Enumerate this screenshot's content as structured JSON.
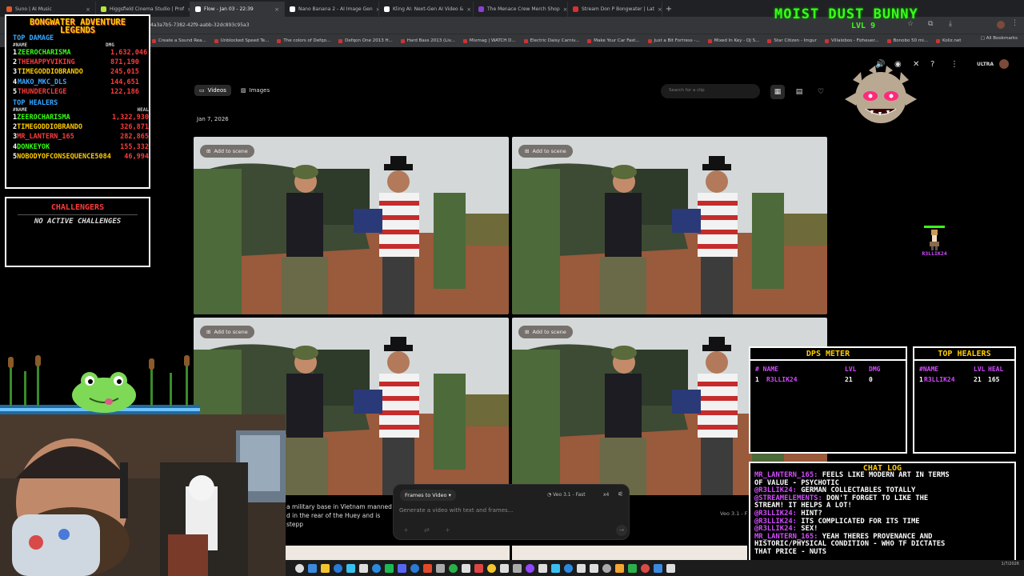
{
  "browser": {
    "tabs": [
      {
        "label": "Suno | AI Music",
        "color": "#e05a2b",
        "active": false
      },
      {
        "label": "Higgsfield Cinema Studio | Prof",
        "color": "#b7e63a",
        "active": false
      },
      {
        "label": "Flow - Jan 03 - 22:39",
        "color": "#ffffff",
        "active": true
      },
      {
        "label": "Nano Banana 2 - AI Image Gen",
        "color": "#ffffff",
        "active": false
      },
      {
        "label": "Kling AI: Next-Gen AI Video &",
        "color": "#ffffff",
        "active": false
      },
      {
        "label": "The Menace Crew Merch Shop",
        "color": "#8b3fd6",
        "active": false
      },
      {
        "label": "Stream Don P Bongwater | Lat",
        "color": "#d93030",
        "active": false
      }
    ],
    "new_tab": "+",
    "url": "4a3a7b5-7382-42f9-aabb-32dc893c95a3",
    "bookmarks": [
      "Create a Sound Rea...",
      "Unblocked Speed Te...",
      "The colors of Defqo...",
      "Defqon One 2013 H...",
      "Hard Bass 2013 (Liv...",
      "Mixmag | WATCH D...",
      "Electric Daisy Carniv...",
      "Make Your Car Fast...",
      "Just a Bit Fortress -...",
      "Mixed In Key - DJ S...",
      "Star Citizen - Imgur",
      "Villalobos - Fizheuer...",
      "Bonobo 50 mi...",
      "Koliz.net"
    ],
    "all_bookmarks": "All Bookmarks"
  },
  "overlay": {
    "title": "MOIST DUST BUNNY",
    "level": "LVL 9",
    "leaderboard": {
      "title_line1": "BONGWATER ADVENTURE",
      "title_line2": "LEGENDS",
      "damage_label": "TOP DAMAGE",
      "col_name": "NAME",
      "col_dmg": "DMG",
      "col_heal": "HEAL",
      "damage": [
        {
          "rank": "1",
          "name": "ZEEROCHARISMA",
          "value": "1,632,046",
          "color": "#39ff14"
        },
        {
          "rank": "2",
          "name": "THEHAPPYVIKING",
          "value": "871,190",
          "color": "#ff3b3b"
        },
        {
          "rank": "3",
          "name": "TIMEGODDIOBRANDO",
          "value": "245,015",
          "color": "#ffcc00"
        },
        {
          "rank": "4",
          "name": "MAKO_MKC_DLS",
          "value": "144,651",
          "color": "#39a8ff"
        },
        {
          "rank": "5",
          "name": "THUNDERCLEGE",
          "value": "122,186",
          "color": "#ff3b3b"
        }
      ],
      "healers_label": "TOP HEALERS",
      "healers": [
        {
          "rank": "1",
          "name": "ZEEROCHARISMA",
          "value": "1,322,930",
          "color": "#39ff14"
        },
        {
          "rank": "2",
          "name": "TIMEGODDIOBRANDO",
          "value": "326,871",
          "color": "#ffcc00"
        },
        {
          "rank": "3",
          "name": "MR_LANTERN_165",
          "value": "282,865",
          "color": "#ff3b3b"
        },
        {
          "rank": "4",
          "name": "DONKEYOK",
          "value": "155,332",
          "color": "#39ff14"
        },
        {
          "rank": "5",
          "name": "NOBODYOFCONSEQUENCE5084",
          "value": "46,994",
          "color": "#ffcc00"
        }
      ]
    },
    "challengers": {
      "title": "CHALLENGERS",
      "status": "NO ACTIVE CHALLENGES"
    },
    "sprite_name": "R3LLIK24",
    "dps": {
      "title": "DPS METER",
      "h_name": "# NAME",
      "h_lvl": "LVL",
      "h_dmg": "DMG",
      "rank": "1",
      "name": "R3LLIK24",
      "lvl": "21",
      "dmg": "0"
    },
    "heal": {
      "title": "TOP HEALERS",
      "h_name": "#NAME",
      "h_lvl": "LVL",
      "h_heal": "HEAL",
      "rank": "1",
      "name": "R3LLIK24",
      "lvl": "21",
      "heal": "165"
    },
    "chat": {
      "title": "CHAT LOG",
      "lines": [
        {
          "user": "MR_LANTERN_165:",
          "text": "FEELS LIKE MODERN ART IN TERMS"
        },
        {
          "user": "",
          "text": "OF VALUE - PSYCHOTIC"
        },
        {
          "user": "@R3LLIK24:",
          "text": "GERMAN COLLECTABLES TOTALLY"
        },
        {
          "user": "@STREAMELEMENTS:",
          "text": "DON'T FORGET TO LIKE THE"
        },
        {
          "user": "",
          "text": "STREAM! IT HELPS A LOT!"
        },
        {
          "user": "@R3LLIK24:",
          "text": "HINT?"
        },
        {
          "user": "@R3LLIK24:",
          "text": "ITS COMPLICATED FOR ITS TIME"
        },
        {
          "user": "@R3LLIK24:",
          "text": "SEX!"
        },
        {
          "user": "MR_LANTERN_165:",
          "text": "YEAH THERES PROVENANCE AND"
        },
        {
          "user": "",
          "text": "HISTORIC/PHYSICAL CONDITION - WHO TF DICTATES"
        },
        {
          "user": "",
          "text": "THAT PRICE - NUTS"
        }
      ]
    }
  },
  "flow": {
    "tab_videos": "Videos",
    "tab_images": "Images",
    "search_placeholder": "Search for a clip",
    "ultra": "ULTRA",
    "date": "Jan 7, 2026",
    "add_to_scene": "Add to scene",
    "prompt_line1": "a military base in Vietnam manned b",
    "prompt_line2": "d in the rear of the Huey and is stepp",
    "mode": "Frames to Video",
    "model": "Veo 3.1 - Fast",
    "count": "x4",
    "placeholder": "Generate a video with text and frames...",
    "model_short": "Veo 3.1 - F"
  },
  "taskbar": {
    "time": "",
    "date": "1/7/2026"
  }
}
